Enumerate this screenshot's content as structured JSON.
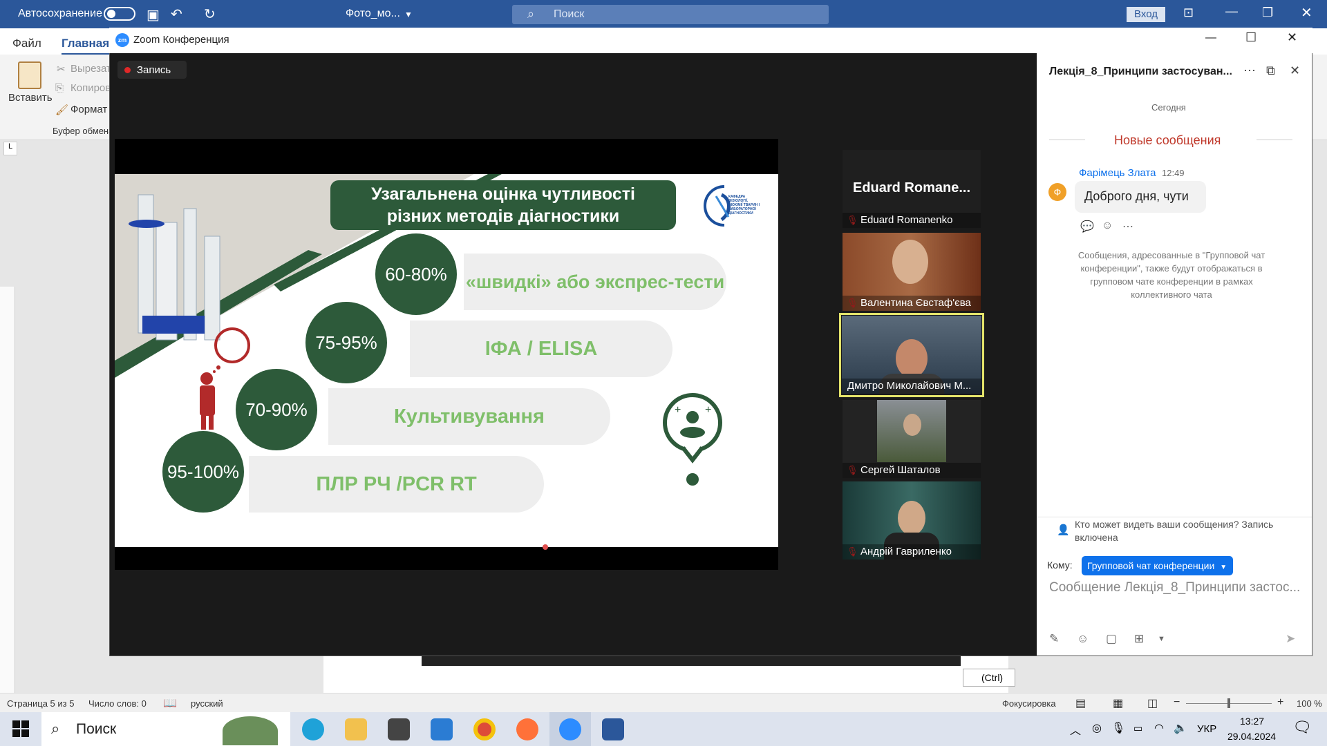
{
  "word": {
    "autosave_label": "Автосохранение",
    "doc_title": "Фото_мо...",
    "search_placeholder": "Поиск",
    "signin_label": "Вход",
    "tab_file": "Файл",
    "tab_home": "Главная",
    "paste_label": "Вставить",
    "cut_label": "Вырезать",
    "copy_label": "Копировать",
    "format_label": "Формат по образцу",
    "clipboard_group": "Буфер обмена",
    "paste_options": "(Ctrl)",
    "status": {
      "page": "Страница 5 из 5",
      "words": "Число слов: 0",
      "lang": "русский",
      "focus": "Фокусировка",
      "zoom": "100 %"
    }
  },
  "taskbar": {
    "search_label": "Поиск",
    "lang": "УКР",
    "time": "13:27",
    "date": "29.04.2024"
  },
  "zoom": {
    "window_title": "Zoom Конференция",
    "logo": "zm",
    "recording_label": "Запись",
    "slide": {
      "title_line1": "Узагальнена оцінка чутливості",
      "title_line2": "різних методів діагностики",
      "rows": [
        {
          "pct": "60-80%",
          "method": "«швидкі» або экспрес-тести"
        },
        {
          "pct": "75-95%",
          "method": "ІФА / ELISA"
        },
        {
          "pct": "70-90%",
          "method": "Культивування"
        },
        {
          "pct": "95-100%",
          "method": "ПЛР РЧ /PCR RT"
        }
      ],
      "logo_text": "КАФЕДРА ФІЗІОЛОГІЇ, БІОХІМІЇ ТВАРИН І ЛАБОРАТОРНОЇ ДІАГНОСТИКИ"
    },
    "participants": [
      {
        "name": "Eduard Romanenko",
        "big_name": "Eduard  Romane..."
      },
      {
        "name": "Валентина Євстаф'єва"
      },
      {
        "name": "Дмитро Миколайович М..."
      },
      {
        "name": "Сергей Шаталов"
      },
      {
        "name": "Андрій Гавриленко"
      }
    ],
    "chat": {
      "title": "Лекція_8_Принципи застосуван...",
      "today": "Сегодня",
      "new_messages": "Новые сообщения",
      "sender": "Фарімець Злата",
      "time": "12:49",
      "avatar_letter": "Ф",
      "message": "Доброго дня, чути",
      "notice": "Сообщения, адресованные в \"Групповой чат конференции\", также будут отображаться в групповом чате конференции в рамках коллективного чата",
      "who_can_see": "Кто может видеть ваши сообщения? Запись включена",
      "to_label": "Кому:",
      "to_value": "Групповой чат конференции",
      "input_placeholder": "Сообщение Лекція_8_Принципи застос...",
      "accent": "#0e71eb",
      "new_msg_color": "#c0392b"
    }
  }
}
